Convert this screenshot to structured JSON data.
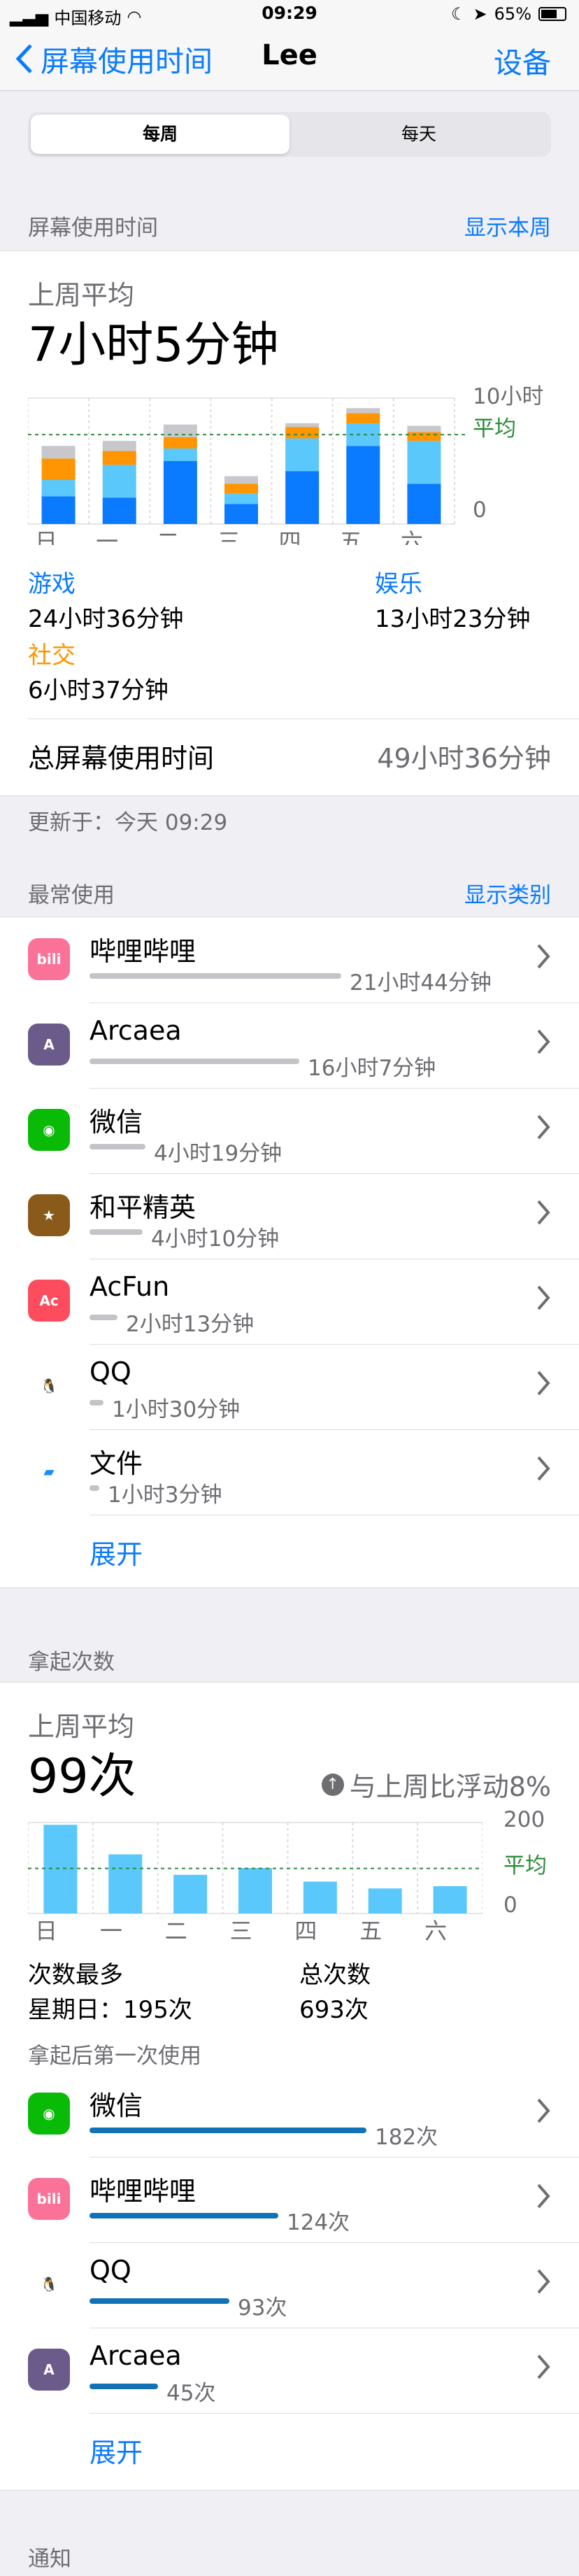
{
  "status": {
    "carrier": "中国移动",
    "time": "09:29",
    "battery": "65%"
  },
  "nav": {
    "back": "屏幕使用时间",
    "title": "Lee",
    "right": "设备"
  },
  "segment": {
    "weekly": "每周",
    "daily": "每天"
  },
  "screen_time": {
    "header": "屏幕使用时间",
    "header_link": "显示本周",
    "avg_label": "上周平均",
    "avg_value": "7小时5分钟",
    "chart_labels": {
      "top": "10小时",
      "avg": "平均",
      "zero": "0"
    },
    "days": [
      "日",
      "一",
      "二",
      "三",
      "四",
      "五",
      "六"
    ],
    "cats": [
      {
        "name": "游戏",
        "value": "24小时36分钟"
      },
      {
        "name": "娱乐",
        "value": "13小时23分钟"
      },
      {
        "name": "社交",
        "value": "6小时37分钟"
      }
    ],
    "total_label": "总屏幕使用时间",
    "total_value": "49小时36分钟",
    "updated": "更新于：今天 09:29"
  },
  "most_used": {
    "header": "最常使用",
    "header_link": "显示类别",
    "apps": [
      {
        "name": "哔哩哔哩",
        "time": "21小时44分钟"
      },
      {
        "name": "Arcaea",
        "time": "16小时7分钟"
      },
      {
        "name": "微信",
        "time": "4小时19分钟"
      },
      {
        "name": "和平精英",
        "time": "4小时10分钟"
      },
      {
        "name": "AcFun",
        "time": "2小时13分钟"
      },
      {
        "name": "QQ",
        "time": "1小时30分钟"
      },
      {
        "name": "文件",
        "time": "1小时3分钟"
      }
    ],
    "more": "展开"
  },
  "pickups": {
    "header": "拿起次数",
    "avg_label": "上周平均",
    "avg_value": "99次",
    "change": "与上周比浮动8%",
    "chart_labels": {
      "top": "200",
      "avg": "平均",
      "zero": "0"
    },
    "days": [
      "日",
      "一",
      "二",
      "三",
      "四",
      "五",
      "六"
    ],
    "max_label": "次数最多",
    "max_value": "星期日：195次",
    "total_label": "总次数",
    "total_value": "693次",
    "first_label": "拿起后第一次使用",
    "apps": [
      {
        "name": "微信",
        "count": "182次"
      },
      {
        "name": "哔哩哔哩",
        "count": "124次"
      },
      {
        "name": "QQ",
        "count": "93次"
      },
      {
        "name": "Arcaea",
        "count": "45次"
      }
    ],
    "more": "展开"
  },
  "notifications": {
    "header": "通知"
  },
  "chart_data": [
    {
      "type": "bar",
      "categories": [
        "日",
        "一",
        "二",
        "三",
        "四",
        "五",
        "六"
      ],
      "series": [
        {
          "name": "游戏",
          "values": [
            2.2,
            2.1,
            5.0,
            1.6,
            4.2,
            6.2,
            3.2
          ]
        },
        {
          "name": "娱乐",
          "values": [
            1.3,
            2.6,
            1.0,
            0.8,
            2.6,
            1.8,
            3.4
          ]
        },
        {
          "name": "社交",
          "values": [
            1.7,
            1.1,
            0.9,
            0.8,
            0.9,
            0.8,
            0.7
          ]
        },
        {
          "name": "",
          "values": [
            1.0,
            0.8,
            1.0,
            0.6,
            0.3,
            0.4,
            0.5
          ]
        }
      ],
      "ylim": [
        0,
        10
      ],
      "average": 7.1
    },
    {
      "type": "bar",
      "categories": [
        "日",
        "一",
        "二",
        "三",
        "四",
        "五",
        "六"
      ],
      "values": [
        195,
        130,
        85,
        100,
        70,
        55,
        60
      ],
      "ylim": [
        0,
        200
      ],
      "average": 99
    }
  ]
}
